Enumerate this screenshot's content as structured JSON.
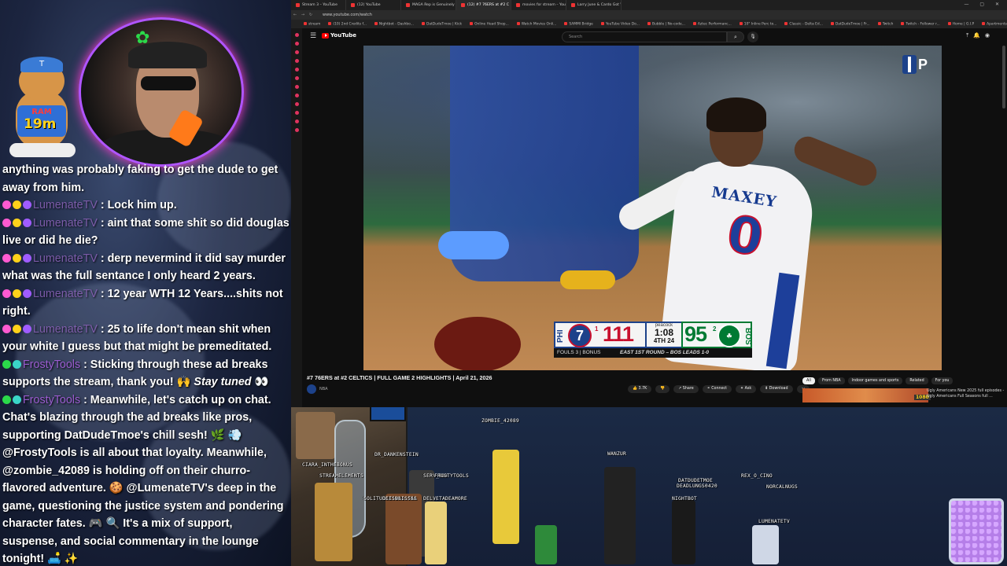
{
  "stream": {
    "bear_timer": "19m",
    "bear_cap_letter": "T",
    "bear_shirt_text": "RAM"
  },
  "chat": [
    {
      "user": "",
      "user_color": "",
      "badge_colors": [],
      "text": "anything was probably faking to get the dude to get away from him."
    },
    {
      "user": "LumenateTV",
      "user_class": "u-lum",
      "badge_colors": [
        "#ff5ad1",
        "#ffd21a",
        "#a05cff"
      ],
      "text": " : Lock him up."
    },
    {
      "user": "LumenateTV",
      "user_class": "u-lum",
      "badge_colors": [
        "#ff5ad1",
        "#ffd21a",
        "#a05cff"
      ],
      "text": " : aint that some shit so did douglas live or did he die?"
    },
    {
      "user": "LumenateTV",
      "user_class": "u-lum",
      "badge_colors": [
        "#ff5ad1",
        "#ffd21a",
        "#a05cff"
      ],
      "text": " : derp nevermind it did say murder what was the full sentance I only heard 2 years."
    },
    {
      "user": "LumenateTV",
      "user_class": "u-lum",
      "badge_colors": [
        "#ff5ad1",
        "#ffd21a",
        "#a05cff"
      ],
      "text": " : 12 year WTH 12 Years....shits not right."
    },
    {
      "user": "LumenateTV",
      "user_class": "u-lum",
      "badge_colors": [
        "#ff5ad1",
        "#ffd21a",
        "#a05cff"
      ],
      "text": " : 25 to life don't mean shit when your white I guess but that might be premeditated."
    },
    {
      "user": "FrostyTools",
      "user_class": "u-fro",
      "badge_colors": [
        "#2bd94a",
        "#3ad6c8"
      ],
      "text": " : Sticking through these ad breaks supports the stream, thank you! 🙌 ",
      "em": "Stay tuned",
      "tail": " 👀"
    },
    {
      "user": "FrostyTools",
      "user_class": "u-fro",
      "badge_colors": [
        "#2bd94a",
        "#3ad6c8"
      ],
      "text": " : Meanwhile, let's catch up on chat. Chat's blazing through the ad breaks like pros, supporting DatDudeTmoe's chill sesh! 🌿 💨 @FrostyTools is all about that loyalty. Meanwhile, @zombie_42089 is holding off on their churro-flavored adventure. 🍪 @LumenateTV's deep in the game, questioning the justice system and pondering character fates. 🎮 🔍 It's a mix of support, suspense, and social commentary in the lounge tonight! 🛋️ ✨"
    }
  ],
  "browser": {
    "tabs": [
      {
        "label": "Stream 3 – YouTube",
        "active": false
      },
      {
        "label": "(12) YouTube",
        "active": false
      },
      {
        "label": "MAGA Rep is Genuinely",
        "active": false
      },
      {
        "label": "(12) #7 76ERS at #2 C",
        "active": true
      },
      {
        "label": "movies for stream – YouT",
        "active": false
      },
      {
        "label": "Larry June & Cardo Got W",
        "active": false
      }
    ],
    "window_controls": "— ▢ ✕",
    "address": "www.youtube.com/watch",
    "bookmarks": [
      "stream",
      "(10) 2nd Credits f...",
      "Nightbot - Dashbo...",
      "DatDudeTmoe | Kick",
      "Online Head Shop...",
      "Watch Movies Onli...",
      "SAMMI Bridge",
      "YouTube Video Do...",
      "Bubble | No-code...",
      "Aztec Performanc...",
      "10\" Inline Perc to...",
      "Classic - Delta Ed...",
      "DatDudeTmoe | Fr...",
      "Twitch",
      "Twitch - Follower r...",
      "Home | G.I.P",
      "Apartments | Luxu..."
    ]
  },
  "youtube": {
    "logo_text": "YouTube",
    "search_placeholder": "Search",
    "video": {
      "jersey_name": "MAXEY",
      "jersey_number": "0",
      "scorebug": {
        "home_abbr": "PHI",
        "home_logo": "7",
        "home_record": "1",
        "home_score": "111",
        "network": "peacock",
        "clock": "1:08",
        "quarter": "4TH",
        "shot_clock": "24",
        "away_score": "95",
        "away_record": "2",
        "away_abbr": "BOS",
        "fouls_text": "FOULS 3 | BONUS",
        "series_text": "EAST 1ST ROUND – BOS LEADS 1-0"
      }
    },
    "title": "#7 76ERS at #2 CELTICS | FULL GAME 2 HIGHLIGHTS | April 21, 2026",
    "channel": "NBA",
    "actions": [
      {
        "label": "👍 3.7K"
      },
      {
        "label": "👎"
      },
      {
        "label": "↗ Share"
      },
      {
        "label": "⚭ Connect"
      },
      {
        "label": "✦ Ask"
      },
      {
        "label": "⬇ Download"
      },
      {
        "label": "···"
      }
    ],
    "chips": [
      {
        "label": "All",
        "selected": true
      },
      {
        "label": "From NBA",
        "selected": false
      },
      {
        "label": "Indoor games and sports",
        "selected": false
      },
      {
        "label": "Related",
        "selected": false
      },
      {
        "label": "For you",
        "selected": false
      }
    ],
    "rec": {
      "hd": "1080",
      "text": "Ugly Americans New 2025 full episodes - Ugly Americans Full Seasons full ..."
    }
  },
  "avatars": [
    {
      "label": "ZOMBIE_42089"
    },
    {
      "label": "DR_DANKENSTEIN"
    },
    {
      "label": "CIARA_INTHEBONUS"
    },
    {
      "label": "STREAMELEMENTS"
    },
    {
      "label": "SERV_BOT"
    },
    {
      "label": "WANZUR"
    },
    {
      "label": "DATDUDETMOE"
    },
    {
      "label": "DEADLUNGS0420"
    },
    {
      "label": "REX_O_CINO"
    },
    {
      "label": "NORCALNUGS"
    },
    {
      "label": "NIGHTBOT"
    },
    {
      "label": "LUMENATETV"
    },
    {
      "label": "GGKSWAGSTAR"
    },
    {
      "label": "SOLITUDEISBLISSSS"
    },
    {
      "label": "DELVETADEAMORE"
    },
    {
      "label": "FROSTYTOOLS"
    }
  ]
}
